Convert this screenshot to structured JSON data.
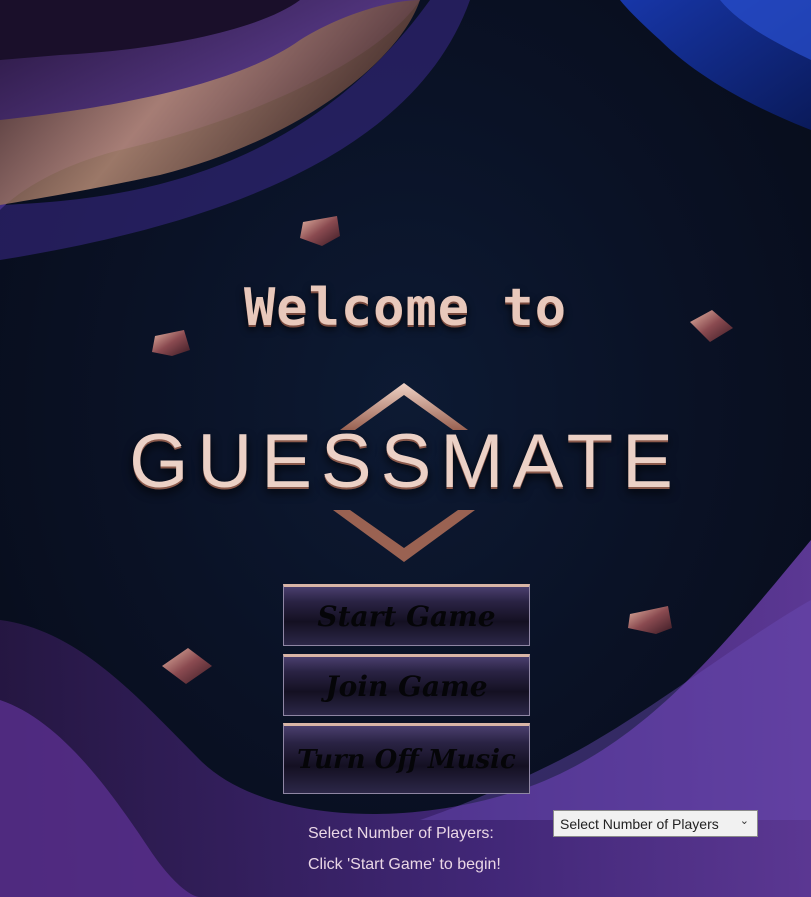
{
  "header": {
    "welcome": "Welcome to"
  },
  "logo": {
    "text": "GUESSMATE"
  },
  "menu": {
    "start": "Start Game",
    "join": "Join Game",
    "music": "Turn Off Music"
  },
  "players": {
    "label": "Select Number of Players:",
    "selected": "Select Number of Players"
  },
  "hint": "Click 'Start Game' to begin!",
  "colors": {
    "background": "#0a1226",
    "title": "#e8c8bb",
    "button_top": "#4a3f6e",
    "button_text": "#050508",
    "label": "#ead7e6"
  }
}
